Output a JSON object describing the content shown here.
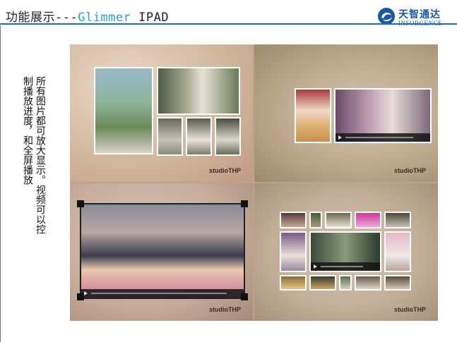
{
  "header": {
    "title_prefix": "功能展示---",
    "title_highlight": "Glimmer",
    "title_suffix": " IPAD",
    "logo_cn": "天智通达",
    "logo_en": "INFORGENCE"
  },
  "description": {
    "line1": "所有图片都可放大显示。视频可以控",
    "line2": "制播放进度，和全屏播放"
  },
  "watermark": "studioTHP",
  "colors": {
    "title_highlight": "#2a9fd6",
    "rule": "#1c6fb0",
    "logo": "#1a56a3"
  }
}
